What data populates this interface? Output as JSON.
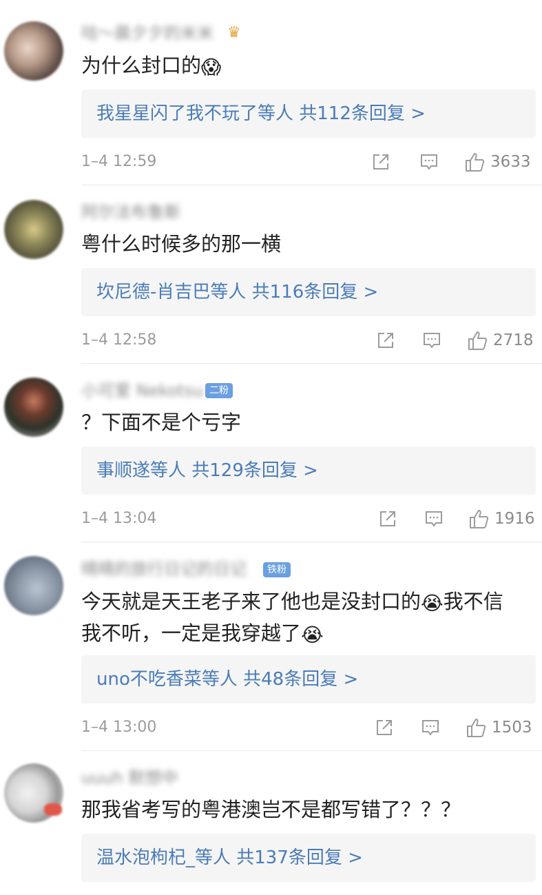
{
  "comments": [
    {
      "username": "咕～晨夕夕的米米",
      "crown_icon": "crown-icon",
      "text": "为什么封口的",
      "emoji": "😱",
      "reply": "我星星闪了我不玩了等人  共112条回复 >",
      "time": "1–4 12:59",
      "likes": "3633"
    },
    {
      "username": "阿尔法布鲁斯",
      "text": "粤什么时候多的那一横",
      "reply": "坎尼德-肖吉巴等人  共116条回复 >",
      "time": "1–4 12:58",
      "likes": "2718"
    },
    {
      "username": "小可爱 Nekotsu",
      "badge": "二粉",
      "text": "？下面不是个亏字",
      "reply": "事顺遂等人  共129条回复 >",
      "time": "1–4 13:04",
      "likes": "1916"
    },
    {
      "username": "晴晴的旅行日记的日记",
      "badge": "铁粉",
      "text_line1": "今天就是天王老子来了他也是没封口的",
      "emoji_mid": "😭",
      "text_line1_end": "我不信",
      "text_line2": "我不听，一定是我穿越了",
      "emoji_end": "😭",
      "reply": "uno不吃香菜等人  共48条回复 >",
      "time": "1–4 13:00",
      "likes": "1503"
    },
    {
      "username": "uuuh 默想中",
      "text": "那我省考写的粤港澳岂不是都写错了？？？",
      "reply": "温水泡枸杞_等人  共137条回复 >"
    }
  ],
  "icons": {
    "share": "share-icon",
    "comment": "comment-icon",
    "like": "thumbs-up-icon"
  },
  "colors": {
    "reply_link": "#4a7cb8",
    "badge": "#6aa0e0",
    "meta_gray": "#9b9b9b"
  }
}
